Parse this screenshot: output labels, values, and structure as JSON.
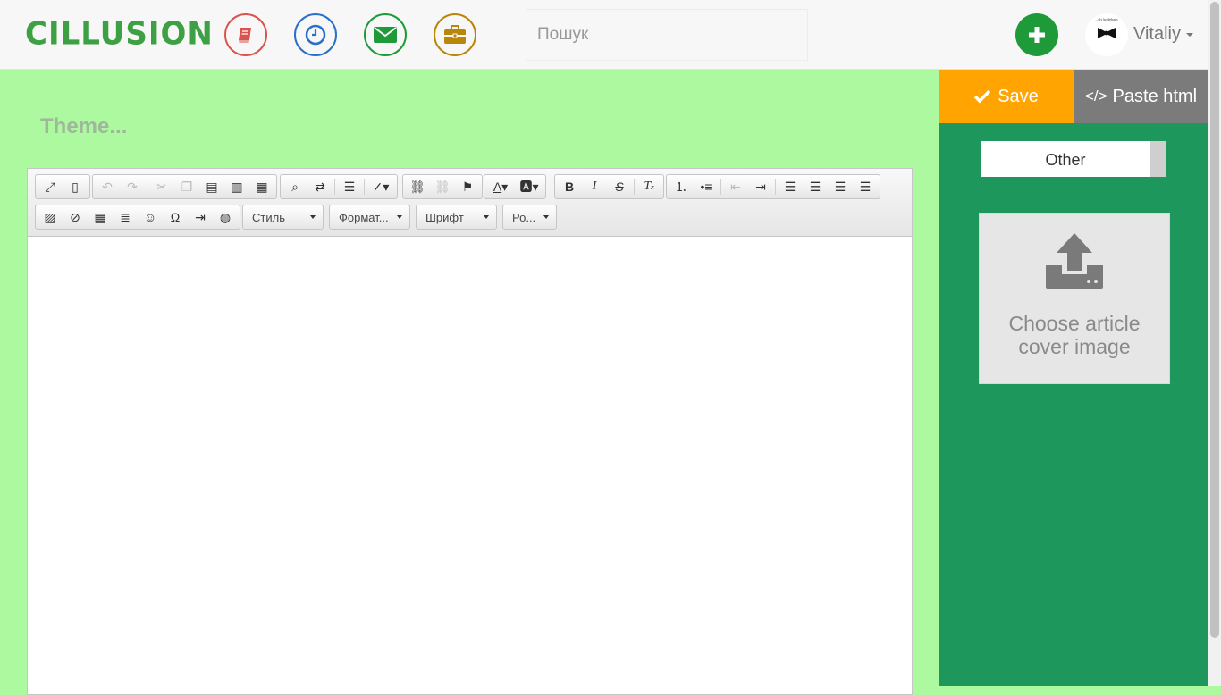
{
  "header": {
    "logo": "CILLUSION",
    "nav_icons": [
      "book-icon",
      "clock-icon",
      "envelope-icon",
      "briefcase-icon"
    ],
    "search_placeholder": "Пошук",
    "add_icon": "plus-icon",
    "user": {
      "name": "Vitaliy",
      "avatar_text": "...ely kredehads"
    }
  },
  "colors": {
    "page_bg": "#adf99f",
    "brand_green": "#3da043",
    "sidebar_green": "#1d975c",
    "save_orange": "#ffa400",
    "paste_gray": "#7b7b7b",
    "nav_red": "#d9534f",
    "nav_blue": "#2a6fc9",
    "nav_green": "#1e9a38",
    "nav_gold": "#b8860b"
  },
  "editor": {
    "theme_placeholder": "Theme...",
    "combos": [
      "Стиль",
      "Формат...",
      "Шрифт",
      "Ро..."
    ],
    "toolbar_icons": [
      "maximize-icon",
      "show-blocks-icon",
      "undo-icon",
      "redo-icon",
      "cut-icon",
      "copy-icon",
      "paste-icon",
      "paste-text-icon",
      "paste-word-icon",
      "find-icon",
      "replace-icon",
      "select-all-icon",
      "spellcheck-icon",
      "link-icon",
      "unlink-icon",
      "anchor-icon",
      "text-color-icon",
      "background-color-icon",
      "bold-icon",
      "italic-icon",
      "strikethrough-icon",
      "remove-format-icon",
      "numbered-list-icon",
      "bulleted-list-icon",
      "outdent-icon",
      "indent-icon",
      "align-left-icon",
      "align-center-icon",
      "align-right-icon",
      "justify-icon",
      "image-icon",
      "flash-icon",
      "table-icon",
      "horizontal-line-icon",
      "smiley-icon",
      "special-char-icon",
      "page-break-icon",
      "iframe-icon"
    ]
  },
  "sidebar": {
    "save_label": "Save",
    "paste_label": "Paste html",
    "category_value": "Other",
    "cover_label_line1": "Choose article",
    "cover_label_line2": "cover image"
  }
}
